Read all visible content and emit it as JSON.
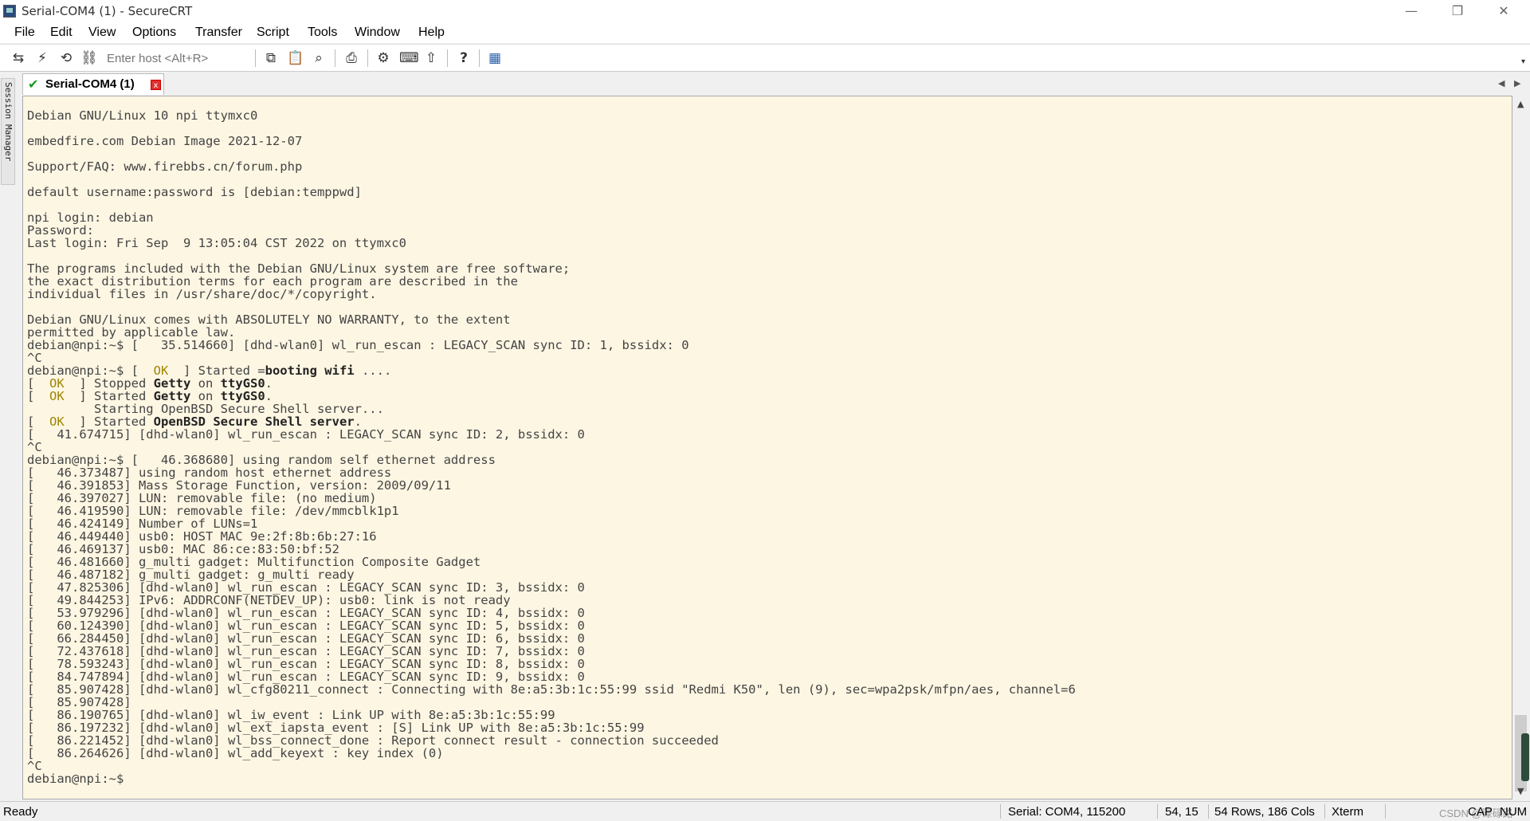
{
  "window": {
    "title": "Serial-COM4 (1) - SecureCRT",
    "minimize_glyph": "—",
    "restore_glyph": "❐",
    "close_glyph": "✕"
  },
  "menu": {
    "items": [
      "File",
      "Edit",
      "View",
      "Options",
      "Transfer",
      "Script",
      "Tools",
      "Window",
      "Help"
    ]
  },
  "toolbar": {
    "host_placeholder": "Enter host <Alt+R>",
    "icons": [
      {
        "name": "connect-icon",
        "glyph": "⇆"
      },
      {
        "name": "quick-connect-icon",
        "glyph": "⚡"
      },
      {
        "name": "reconnect-icon",
        "glyph": "⟲"
      },
      {
        "name": "disconnect-icon",
        "glyph": "⛓"
      },
      {
        "name": "copy-icon",
        "glyph": "⧉"
      },
      {
        "name": "paste-icon",
        "glyph": "📋"
      },
      {
        "name": "find-icon",
        "glyph": "⌕"
      },
      {
        "name": "print-icon",
        "glyph": "⎙"
      },
      {
        "name": "settings-icon",
        "glyph": "⚙"
      },
      {
        "name": "keymap-icon",
        "glyph": "⌨"
      },
      {
        "name": "sftp-icon",
        "glyph": "⇧"
      },
      {
        "name": "help-icon",
        "glyph": "?"
      },
      {
        "name": "script-icon",
        "glyph": "▦"
      }
    ],
    "dropdown_glyph": "▾"
  },
  "sidebar": {
    "session_manager_label": "Session Manager"
  },
  "tabs": [
    {
      "label": "Serial-COM4 (1)",
      "status_glyph": "✔",
      "close_glyph": "x"
    }
  ],
  "tab_nav": {
    "left": "◀",
    "right": "▶"
  },
  "terminal": {
    "lines": [
      "Debian GNU/Linux 10 npi ttymxc0",
      "",
      "embedfire.com Debian Image 2021-12-07",
      "",
      "Support/FAQ: www.firebbs.cn/forum.php",
      "",
      "default username:password is [debian:temppwd]",
      "",
      "npi login: debian",
      "Password:",
      "Last login: Fri Sep  9 13:05:04 CST 2022 on ttymxc0",
      "",
      "The programs included with the Debian GNU/Linux system are free software;",
      "the exact distribution terms for each program are described in the",
      "individual files in /usr/share/doc/*/copyright.",
      "",
      "Debian GNU/Linux comes with ABSOLUTELY NO WARRANTY, to the extent",
      "permitted by applicable law.",
      "debian@npi:~$ [   35.514660] [dhd-wlan0] wl_run_escan : LEGACY_SCAN sync ID: 1, bssidx: 0",
      "^C",
      "debian@npi:~$ [  OK  ] Started =booting wifi ....",
      "[  OK  ] Stopped Getty on ttyGS0.",
      "[  OK  ] Started Getty on ttyGS0.",
      "         Starting OpenBSD Secure Shell server...",
      "[  OK  ] Started OpenBSD Secure Shell server.",
      "[   41.674715] [dhd-wlan0] wl_run_escan : LEGACY_SCAN sync ID: 2, bssidx: 0",
      "^C",
      "debian@npi:~$ [   46.368680] using random self ethernet address",
      "[   46.373487] using random host ethernet address",
      "[   46.391853] Mass Storage Function, version: 2009/09/11",
      "[   46.397027] LUN: removable file: (no medium)",
      "[   46.419590] LUN: removable file: /dev/mmcblk1p1",
      "[   46.424149] Number of LUNs=1",
      "[   46.449440] usb0: HOST MAC 9e:2f:8b:6b:27:16",
      "[   46.469137] usb0: MAC 86:ce:83:50:bf:52",
      "[   46.481660] g_multi gadget: Multifunction Composite Gadget",
      "[   46.487182] g_multi gadget: g_multi ready",
      "[   47.825306] [dhd-wlan0] wl_run_escan : LEGACY_SCAN sync ID: 3, bssidx: 0",
      "[   49.844253] IPv6: ADDRCONF(NETDEV_UP): usb0: link is not ready",
      "[   53.979296] [dhd-wlan0] wl_run_escan : LEGACY_SCAN sync ID: 4, bssidx: 0",
      "[   60.124390] [dhd-wlan0] wl_run_escan : LEGACY_SCAN sync ID: 5, bssidx: 0",
      "[   66.284450] [dhd-wlan0] wl_run_escan : LEGACY_SCAN sync ID: 6, bssidx: 0",
      "[   72.437618] [dhd-wlan0] wl_run_escan : LEGACY_SCAN sync ID: 7, bssidx: 0",
      "[   78.593243] [dhd-wlan0] wl_run_escan : LEGACY_SCAN sync ID: 8, bssidx: 0",
      "[   84.747894] [dhd-wlan0] wl_run_escan : LEGACY_SCAN sync ID: 9, bssidx: 0",
      "[   85.907428] [dhd-wlan0] wl_cfg80211_connect : Connecting with 8e:a5:3b:1c:55:99 ssid \"Redmi K50\", len (9), sec=wpa2psk/mfpn/aes, channel=6",
      "[   85.907428]",
      "[   86.190765] [dhd-wlan0] wl_iw_event : Link UP with 8e:a5:3b:1c:55:99",
      "[   86.197232] [dhd-wlan0] wl_ext_iapsta_event : [S] Link UP with 8e:a5:3b:1c:55:99",
      "[   86.221452] [dhd-wlan0] wl_bss_connect_done : Report connect result - connection succeeded",
      "[   86.264626] [dhd-wlan0] wl_add_keyext : key index (0)",
      "^C",
      "debian@npi:~$ "
    ],
    "ok_token": "  OK  ",
    "bold_tokens": [
      "booting wifi",
      "Getty",
      "ttyGS0",
      "OpenBSD Secure Shell server"
    ]
  },
  "statusbar": {
    "ready": "Ready",
    "connection": "Serial: COM4, 115200",
    "cursor": "54, 15",
    "size": "54 Rows, 186 Cols",
    "emulation": "Xterm",
    "caps": "CAP",
    "num": "NUM",
    "watermark": "CSDN @碌碌路"
  },
  "colors": {
    "terminal_bg": "#fdf6e3",
    "terminal_fg": "#444444",
    "ok": "#a08400",
    "tab_check": "#1a9a1a",
    "tab_close": "#e03030"
  }
}
